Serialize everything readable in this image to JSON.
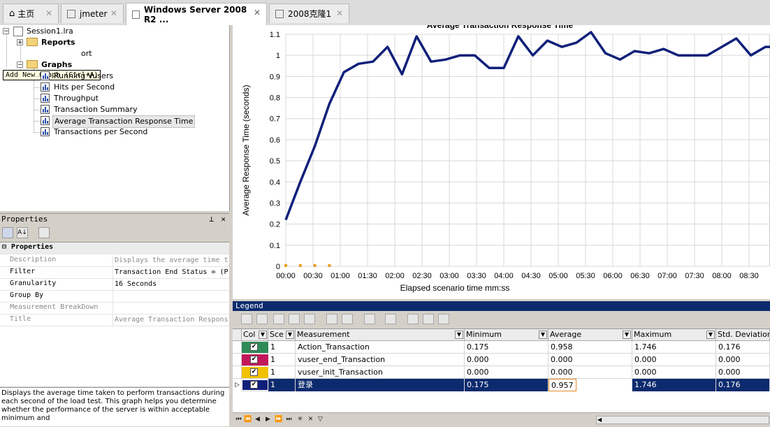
{
  "tabs": [
    {
      "label": "主页",
      "icon": "home-icon"
    },
    {
      "label": "jmeter",
      "icon": "window-icon"
    },
    {
      "label": "Windows Server 2008 R2 ...",
      "icon": "window-icon"
    },
    {
      "label": "2008克隆1",
      "icon": "window-icon"
    }
  ],
  "tree": {
    "session": "Session1.lra",
    "reports": "Reports",
    "report_item": "ort",
    "tooltip": "Add New Graph (Ctrl+A)",
    "graphs": "Graphs",
    "items": [
      "Running Vusers",
      "Hits per Second",
      "Throughput",
      "Transaction Summary",
      "Average Transaction Response Time",
      "Transactions per Second"
    ]
  },
  "properties": {
    "header": "Properties",
    "section": "Properties",
    "rows": [
      {
        "name": "Description",
        "value": "Displays the average time t",
        "dim": true
      },
      {
        "name": "Filter",
        "value": "Transaction End Status = (P",
        "dim": false
      },
      {
        "name": "Granularity",
        "value": "16 Seconds",
        "dim": false
      },
      {
        "name": "Group By",
        "value": "",
        "dim": false
      },
      {
        "name": "Measurement BreakDown",
        "value": "",
        "dim": true
      },
      {
        "name": "Title",
        "value": "Average Transaction Respons",
        "dim": true
      }
    ],
    "description": "Displays the average time taken to perform transactions during each second of the load test. This graph helps you determine whether the performance of the server is within acceptable minimum and"
  },
  "chart_data": {
    "type": "line",
    "title": "Average Transaction Response Time",
    "xlabel": "Elapsed scenario time mm:ss",
    "ylabel": "Average Response Time (seconds)",
    "ylim": [
      0,
      1.1
    ],
    "yticks": [
      0,
      0.1,
      0.2,
      0.3,
      0.4,
      0.5,
      0.6,
      0.7,
      0.8,
      0.9,
      1,
      1.1
    ],
    "xticks": [
      "00:00",
      "00:30",
      "01:00",
      "01:30",
      "02:00",
      "02:30",
      "03:00",
      "03:30",
      "04:00",
      "04:30",
      "05:00",
      "05:30",
      "06:00",
      "06:30",
      "07:00",
      "07:30",
      "08:00",
      "08:30"
    ],
    "grid": true,
    "series": [
      {
        "color": "#10207a",
        "x_seconds": [
          0,
          16,
          32,
          48,
          64,
          80,
          96,
          112,
          128,
          144,
          160,
          176,
          192,
          208,
          224,
          240,
          256,
          272,
          288,
          304,
          320,
          336,
          352,
          368,
          384,
          400,
          416,
          432,
          448,
          464,
          480,
          496,
          512,
          528,
          544,
          560,
          576
        ],
        "values": [
          0.22,
          0.4,
          0.57,
          0.77,
          0.92,
          0.96,
          0.97,
          1.04,
          0.91,
          1.09,
          0.97,
          0.98,
          1.0,
          1.0,
          0.94,
          0.94,
          1.09,
          1.0,
          1.07,
          1.04,
          1.06,
          1.11,
          1.01,
          0.98,
          1.02,
          1.01,
          1.03,
          1.0,
          1.0,
          1.0,
          1.04,
          1.08,
          1.0,
          1.04,
          1.04,
          1.0,
          1.0
        ]
      },
      {
        "color": "#e8a020",
        "x_seconds": [
          0,
          16,
          32,
          48
        ],
        "values": [
          0,
          0,
          0,
          0
        ]
      }
    ]
  },
  "legend": {
    "title": "Legend",
    "columns": [
      "Col",
      "Sce",
      "Measurement",
      "Minimum",
      "Average",
      "Maximum",
      "Std. Deviation"
    ],
    "rows": [
      {
        "color": "#2e8b57",
        "checked": "✔",
        "scale": "1",
        "measurement": "Action_Transaction",
        "min": "0.175",
        "avg": "0.958",
        "max": "1.746",
        "std": "0.176"
      },
      {
        "color": "#c2185b",
        "checked": "✔",
        "scale": "1",
        "measurement": "vuser_end_Transaction",
        "min": "0.000",
        "avg": "0.000",
        "max": "0.000",
        "std": "0.000"
      },
      {
        "color": "#f2c200",
        "checked": "✔",
        "scale": "1",
        "measurement": "vuser_init_Transaction",
        "min": "0.000",
        "avg": "0.000",
        "max": "0.000",
        "std": "0.000"
      },
      {
        "color": "#10207a",
        "checked": "✔",
        "scale": "1",
        "measurement": "登录",
        "min": "0.175",
        "avg": "0.957",
        "max": "1.746",
        "std": "0.176"
      }
    ]
  }
}
